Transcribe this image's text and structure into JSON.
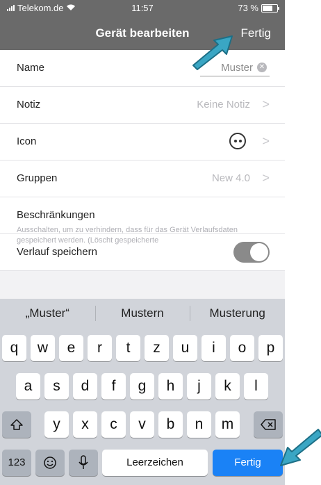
{
  "status": {
    "carrier": "Telekom.de",
    "time": "11:57",
    "battery": "73 %"
  },
  "nav": {
    "title": "Gerät bearbeiten",
    "done": "Fertig"
  },
  "rows": {
    "name": {
      "label": "Name",
      "value": "Muster"
    },
    "notiz": {
      "label": "Notiz",
      "value": "Keine Notiz"
    },
    "icon": {
      "label": "Icon"
    },
    "gruppen": {
      "label": "Gruppen",
      "value": "New 4.0"
    },
    "beschraenkungen": {
      "label": "Beschränkungen"
    },
    "verlauf": {
      "label": "Verlauf speichern",
      "enabled": true
    }
  },
  "footnote": "Ausschalten, um zu verhindern, dass für das Gerät Verlaufsdaten gespeichert werden. (Löscht gespeicherte",
  "keyboard": {
    "suggestions": [
      "„Muster“",
      "Mustern",
      "Musterung"
    ],
    "row1": [
      "q",
      "w",
      "e",
      "r",
      "t",
      "z",
      "u",
      "i",
      "o",
      "p"
    ],
    "row2": [
      "a",
      "s",
      "d",
      "f",
      "g",
      "h",
      "j",
      "k",
      "l"
    ],
    "row3": [
      "y",
      "x",
      "c",
      "v",
      "b",
      "n",
      "m"
    ],
    "numbers": "123",
    "space": "Leerzeichen",
    "done": "Fertig"
  },
  "colors": {
    "navbar": "#6a6a6a",
    "accent_blue": "#1a82f6",
    "annotation_arrow": "#3aa6c4"
  }
}
